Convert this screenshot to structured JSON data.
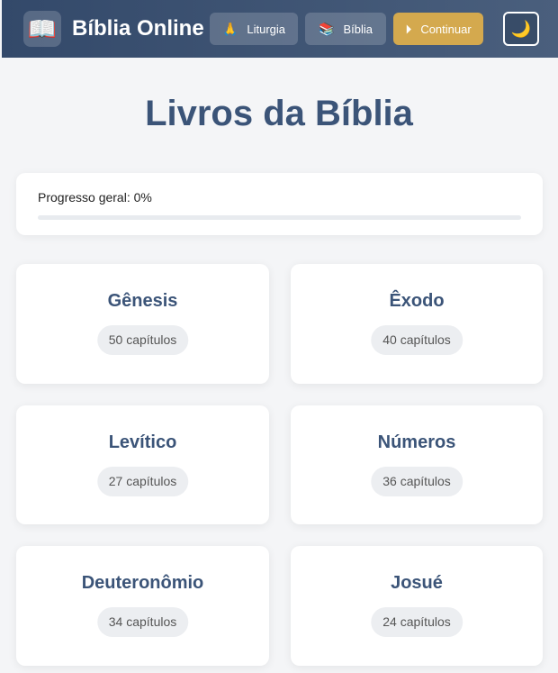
{
  "header": {
    "brand_icon": "open-book-icon",
    "brand_title": "Bíblia Online",
    "nav": {
      "liturgia": {
        "icon": "🙏",
        "label": "Liturgia"
      },
      "biblia": {
        "icon": "📚",
        "label": "Bíblia"
      },
      "continuar": {
        "icon": "⏵",
        "label": "Continuar"
      }
    },
    "theme_toggle_icon": "🌙"
  },
  "main": {
    "title": "Livros da Bíblia",
    "progress": {
      "label": "Progresso geral: 0%",
      "value": 0
    },
    "books": [
      {
        "name": "Gênesis",
        "chapters": "50 capítulos"
      },
      {
        "name": "Êxodo",
        "chapters": "40 capítulos"
      },
      {
        "name": "Levítico",
        "chapters": "27 capítulos"
      },
      {
        "name": "Números",
        "chapters": "36 capítulos"
      },
      {
        "name": "Deuteronômio",
        "chapters": "34 capítulos"
      },
      {
        "name": "Josué",
        "chapters": "24 capítulos"
      }
    ]
  },
  "colors": {
    "header_start": "#33496a",
    "accent": "#d4a94e",
    "title": "#3b5478"
  }
}
